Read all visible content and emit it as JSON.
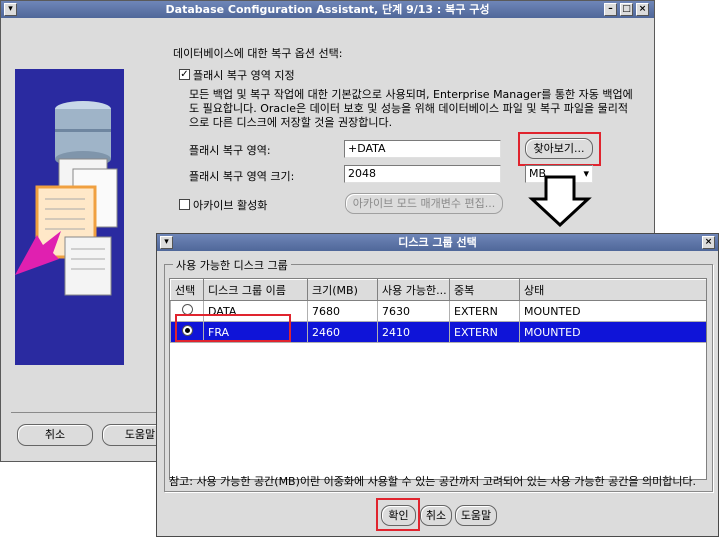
{
  "main_window": {
    "title": "Database Configuration Assistant, 단계 9/13 : 복구 구성",
    "section_label": "데이터베이스에 대한 복구 옵션 선택:",
    "flash_checkbox_label": "플래시 복구 영역 지정",
    "description": "모든 백업 및 복구 작업에 대한 기본값으로 사용되며, Enterprise Manager를 통한 자동 백업에도 필요합니다. Oracle은 데이터 보호 및 성능을 위해 데이터베이스 파일 및 복구 파일을 물리적으로 다른 디스크에 저장할 것을 권장합니다.",
    "flash_area_label": "플래시 복구 영역:",
    "flash_area_value": "+DATA",
    "browse_button": "찾아보기...",
    "flash_size_label": "플래시 복구 영역 크기:",
    "flash_size_value": "2048",
    "size_unit": "MB",
    "archive_checkbox_label": "아카이브 활성화",
    "archive_params_button": "아카이브 모드 매개변수 편집...",
    "cancel_button": "취소",
    "help_button": "도움말"
  },
  "dialog": {
    "title": "디스크 그룹 선택",
    "group_label": "사용 가능한 디스크 그룹",
    "columns": [
      "선택",
      "디스크 그룹 이름",
      "크기(MB)",
      "사용 가능한...",
      "중복",
      "상태"
    ],
    "rows": [
      {
        "selected": false,
        "name": "DATA",
        "size": "7680",
        "free": "7630",
        "redundancy": "EXTERN",
        "status": "MOUNTED"
      },
      {
        "selected": true,
        "name": "FRA",
        "size": "2460",
        "free": "2410",
        "redundancy": "EXTERN",
        "status": "MOUNTED"
      }
    ],
    "note": "참고: 사용 가능한 공간(MB)이란 이중화에 사용할 수 있는 공간까지 고려되어 있는 사용 가능한 공간을 의미합니다.",
    "ok_button": "확인",
    "cancel_button": "취소",
    "help_button": "도움말"
  },
  "colors": {
    "title_bar": "#4f6799",
    "selection": "#0f14d8",
    "highlight": "#e0242e",
    "illustration_bg": "#2a2aa0"
  }
}
